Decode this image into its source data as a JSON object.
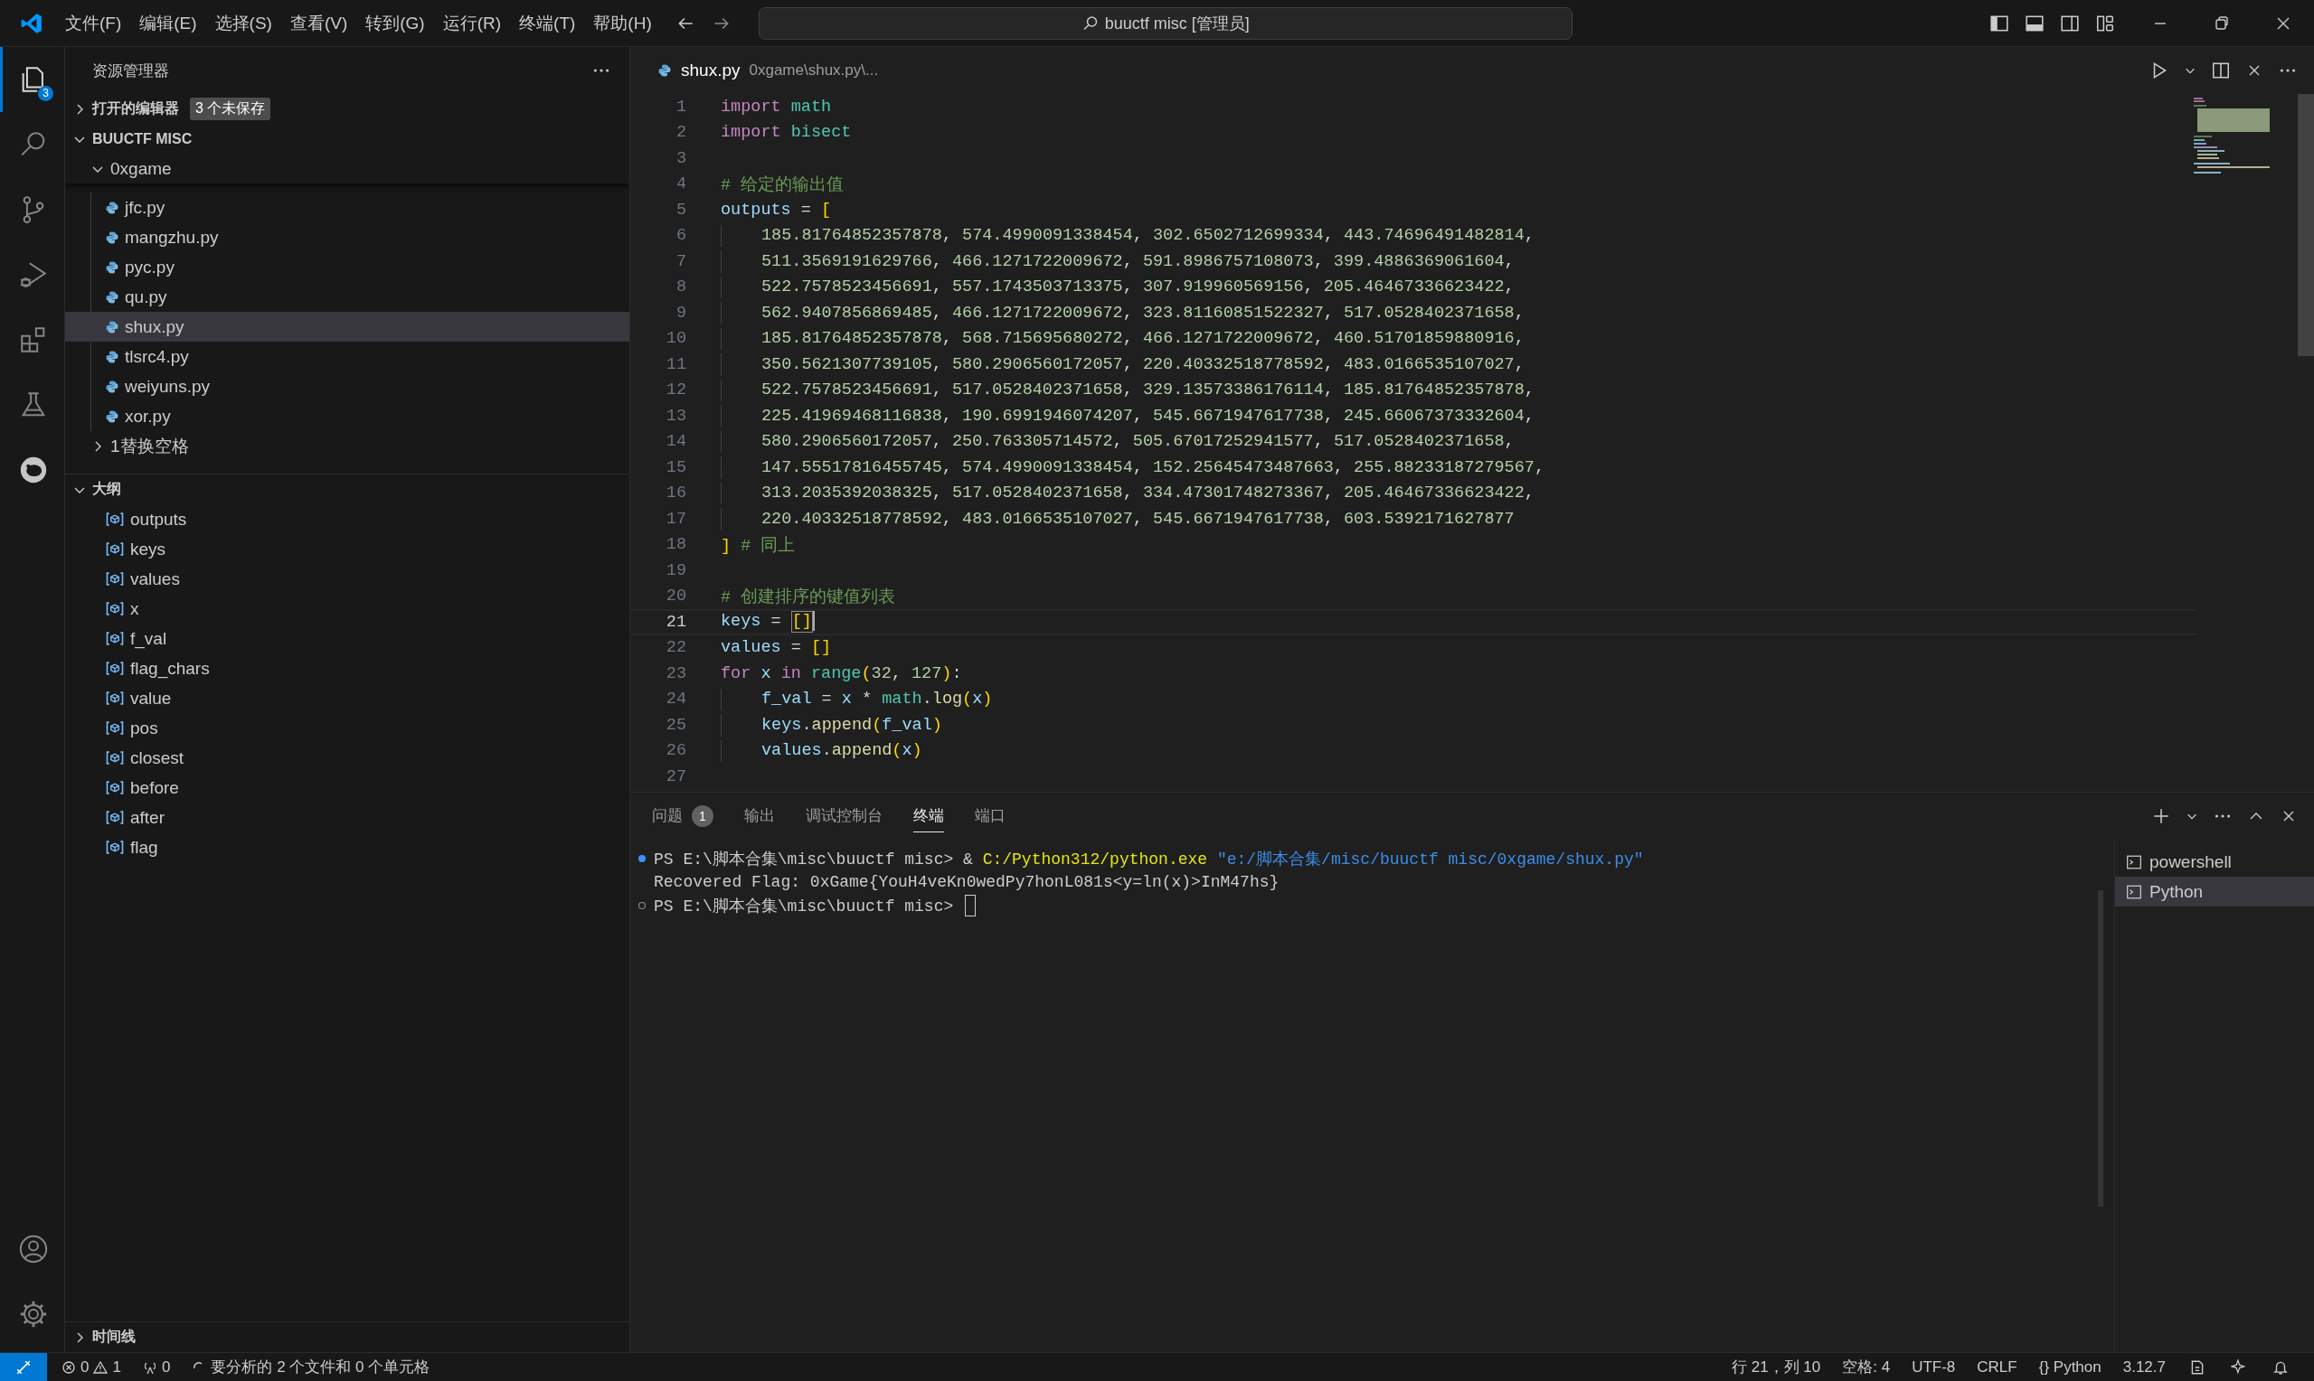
{
  "title_bar": {
    "menus": [
      "文件(F)",
      "编辑(E)",
      "选择(S)",
      "查看(V)",
      "转到(G)",
      "运行(R)",
      "终端(T)",
      "帮助(H)"
    ],
    "command_center": "buuctf misc [管理员]"
  },
  "activity_bar": {
    "items": [
      {
        "kind": "explorer",
        "selected": true,
        "badge": "3"
      },
      {
        "kind": "search",
        "selected": false
      },
      {
        "kind": "source-control",
        "selected": false
      },
      {
        "kind": "run-debug",
        "selected": false
      },
      {
        "kind": "extensions",
        "selected": false
      },
      {
        "kind": "testing",
        "selected": false
      },
      {
        "kind": "pig",
        "selected": false
      }
    ],
    "bottom": [
      {
        "kind": "account"
      },
      {
        "kind": "settings"
      }
    ]
  },
  "sidebar": {
    "title": "资源管理器",
    "open_editors": {
      "label": "打开的编辑器",
      "badge": "3 个未保存",
      "expanded": false
    },
    "workspace": {
      "label": "BUUCTF MISC",
      "expanded": true
    },
    "folder": {
      "label": "0xgame",
      "expanded": true
    },
    "files": [
      {
        "name": "jfc.py",
        "selected": false
      },
      {
        "name": "mangzhu.py",
        "selected": false
      },
      {
        "name": "pyc.py",
        "selected": false
      },
      {
        "name": "qu.py",
        "selected": false
      },
      {
        "name": "shux.py",
        "selected": true
      },
      {
        "name": "tlsrc4.py",
        "selected": false
      },
      {
        "name": "weiyuns.py",
        "selected": false
      },
      {
        "name": "xor.py",
        "selected": false
      }
    ],
    "subfolder": {
      "label": "1替换空格",
      "expanded": false
    },
    "outline": {
      "label": "大纲",
      "expanded": true,
      "items": [
        "outputs",
        "keys",
        "values",
        "x",
        "f_val",
        "flag_chars",
        "value",
        "pos",
        "closest",
        "before",
        "after",
        "flag"
      ]
    },
    "timeline": {
      "label": "时间线",
      "expanded": false
    }
  },
  "editor": {
    "tab": {
      "name": "shux.py",
      "path": "0xgame\\shux.py\\..."
    },
    "lines": [
      {
        "number": "1",
        "current": false,
        "tokens": [
          {
            "kind": "kw",
            "text": "import"
          },
          {
            "kind": "mod",
            "text": " math"
          }
        ]
      },
      {
        "number": "2",
        "current": false,
        "tokens": [
          {
            "kind": "kw",
            "text": "import"
          },
          {
            "kind": "mod",
            "text": " bisect"
          }
        ]
      },
      {
        "number": "3",
        "current": false
      },
      {
        "number": "4",
        "current": false,
        "tokens": [
          {
            "kind": "cm",
            "text": "# 给定的输出值"
          }
        ]
      },
      {
        "number": "5",
        "current": false,
        "tokens": [
          {
            "kind": "var",
            "text": "outputs"
          },
          {
            "kind": "op",
            "text": " = "
          },
          {
            "kind": "br",
            "text": "["
          }
        ],
        "children": [
          {
            "number": "6",
            "current": false,
            "tokens": [
              {
                "kind": "nums",
                "text": "185.81764852357878, 574.4990091338454, 302.6502712699334, 443.74696491482814,"
              }
            ]
          },
          {
            "number": "7",
            "current": false,
            "tokens": [
              {
                "kind": "nums",
                "text": "511.3569191629766, 466.1271722009672, 591.8986757108073, 399.4886369061604,"
              }
            ]
          },
          {
            "number": "8",
            "current": false,
            "tokens": [
              {
                "kind": "nums",
                "text": "522.7578523456691, 557.1743503713375, 307.919960569156, 205.46467336623422,"
              }
            ]
          },
          {
            "number": "9",
            "current": false,
            "tokens": [
              {
                "kind": "nums",
                "text": "562.9407856869485, 466.1271722009672, 323.81160851522327, 517.0528402371658,"
              }
            ]
          },
          {
            "number": "10",
            "current": false,
            "tokens": [
              {
                "kind": "nums",
                "text": "185.81764852357878, 568.715695680272, 466.1271722009672, 460.51701859880916,"
              }
            ]
          },
          {
            "number": "11",
            "current": false,
            "tokens": [
              {
                "kind": "nums",
                "text": "350.5621307739105, 580.2906560172057, 220.40332518778592, 483.0166535107027,"
              }
            ]
          },
          {
            "number": "12",
            "current": false,
            "tokens": [
              {
                "kind": "nums",
                "text": "522.7578523456691, 517.0528402371658, 329.13573386176114, 185.81764852357878,"
              }
            ]
          },
          {
            "number": "13",
            "current": false,
            "tokens": [
              {
                "kind": "nums",
                "text": "225.41969468116838, 190.6991946074207, 545.6671947617738, 245.66067373332604,"
              }
            ]
          },
          {
            "number": "14",
            "current": false,
            "tokens": [
              {
                "kind": "nums",
                "text": "580.2906560172057, 250.763305714572, 505.67017252941577, 517.0528402371658,"
              }
            ]
          },
          {
            "number": "15",
            "current": false,
            "tokens": [
              {
                "kind": "nums",
                "text": "147.55517816455745, 574.4990091338454, 152.25645473487663, 255.88233187279567,"
              }
            ]
          },
          {
            "number": "16",
            "current": false,
            "tokens": [
              {
                "kind": "nums",
                "text": "313.2035392038325, 517.0528402371658, 334.47301748273367, 205.46467336623422,"
              }
            ]
          },
          {
            "number": "17",
            "current": false,
            "tokens": [
              {
                "kind": "nums",
                "text": "220.40332518778592, 483.0166535107027, 545.6671947617738, 603.5392171627877"
              }
            ]
          }
        ]
      },
      {
        "number": "18",
        "current": false,
        "tokens": [
          {
            "kind": "br",
            "text": "]"
          },
          {
            "kind": "cm",
            "text": " # 同上"
          }
        ]
      },
      {
        "number": "19",
        "current": false
      },
      {
        "number": "20",
        "current": false,
        "tokens": [
          {
            "kind": "cm",
            "text": "# 创建排序的键值列表"
          }
        ]
      },
      {
        "number": "21",
        "current": true,
        "tokens": [
          {
            "kind": "var",
            "text": "keys"
          },
          {
            "kind": "op",
            "text": " = "
          },
          {
            "kind": "match",
            "text": "[]"
          }
        ]
      },
      {
        "number": "22",
        "current": false,
        "tokens": [
          {
            "kind": "var",
            "text": "values"
          },
          {
            "kind": "op",
            "text": " = "
          },
          {
            "kind": "br",
            "text": "[]"
          }
        ]
      },
      {
        "number": "23",
        "current": false,
        "tokens": [
          {
            "kind": "kw",
            "text": "for"
          },
          {
            "kind": "var",
            "text": " x"
          },
          {
            "kind": "kw",
            "text": " in"
          },
          {
            "kind": "mod",
            "text": " range"
          },
          {
            "kind": "br",
            "text": "("
          },
          {
            "kind": "num",
            "text": "32"
          },
          {
            "kind": "op",
            "text": ", "
          },
          {
            "kind": "num",
            "text": "127"
          },
          {
            "kind": "br",
            "text": ")"
          },
          {
            "kind": "op",
            "text": ":"
          }
        ],
        "children": [
          {
            "number": "24",
            "current": false,
            "tokens": [
              {
                "kind": "var",
                "text": "f_val"
              },
              {
                "kind": "op",
                "text": " = "
              },
              {
                "kind": "var",
                "text": "x"
              },
              {
                "kind": "op",
                "text": " * "
              },
              {
                "kind": "mod",
                "text": "math"
              },
              {
                "kind": "op",
                "text": "."
              },
              {
                "kind": "fn",
                "text": "log"
              },
              {
                "kind": "br",
                "text": "("
              },
              {
                "kind": "var",
                "text": "x"
              },
              {
                "kind": "br",
                "text": ")"
              }
            ]
          },
          {
            "number": "25",
            "current": false,
            "tokens": [
              {
                "kind": "var",
                "text": "keys"
              },
              {
                "kind": "op",
                "text": "."
              },
              {
                "kind": "fn",
                "text": "append"
              },
              {
                "kind": "br",
                "text": "("
              },
              {
                "kind": "var",
                "text": "f_val"
              },
              {
                "kind": "br",
                "text": ")"
              }
            ]
          },
          {
            "number": "26",
            "current": false,
            "tokens": [
              {
                "kind": "var",
                "text": "values"
              },
              {
                "kind": "op",
                "text": "."
              },
              {
                "kind": "fn",
                "text": "append"
              },
              {
                "kind": "br",
                "text": "("
              },
              {
                "kind": "var",
                "text": "x"
              },
              {
                "kind": "br",
                "text": ")"
              }
            ]
          }
        ]
      },
      {
        "number": "27",
        "current": false
      }
    ]
  },
  "panel": {
    "tabs": [
      {
        "label": "问题",
        "badge": "1",
        "selected": false
      },
      {
        "label": "输出",
        "selected": false
      },
      {
        "label": "调试控制台",
        "selected": false
      },
      {
        "label": "终端",
        "selected": true
      },
      {
        "label": "端口",
        "selected": false
      }
    ],
    "terminal": {
      "lines": [
        {
          "kind": "success",
          "tokens": [
            {
              "kind": "plain",
              "text": "PS E:\\脚本合集\\misc\\buuctf misc> & "
            },
            {
              "kind": "cmd",
              "text": "C:/Python312/python.exe"
            },
            {
              "kind": "str",
              "text": " \"e:/脚本合集/misc/buuctf misc/0xgame/shux.py\""
            }
          ]
        },
        {
          "kind": "output",
          "tokens": [
            {
              "kind": "plain",
              "text": "Recovered Flag: 0xGame{YouH4veKn0wedPy7honL081s<y=ln(x)>InM47hs}"
            }
          ]
        },
        {
          "kind": "pending",
          "cursor": true,
          "tokens": [
            {
              "kind": "plain",
              "text": "PS E:\\脚本合集\\misc\\buuctf misc> "
            }
          ]
        }
      ],
      "sessions": [
        {
          "name": "powershell",
          "selected": false
        },
        {
          "name": "Python",
          "selected": true
        }
      ]
    }
  },
  "status_bar": {
    "errors": "0",
    "warnings": "1",
    "ports": "0",
    "analysis": "要分析的 2 个文件和 0 个单元格",
    "position": "行 21，列 10",
    "indent": "空格: 4",
    "encoding": "UTF-8",
    "eol": "CRLF",
    "language": "Python",
    "language_icon": "{}",
    "version": "3.12.7"
  }
}
